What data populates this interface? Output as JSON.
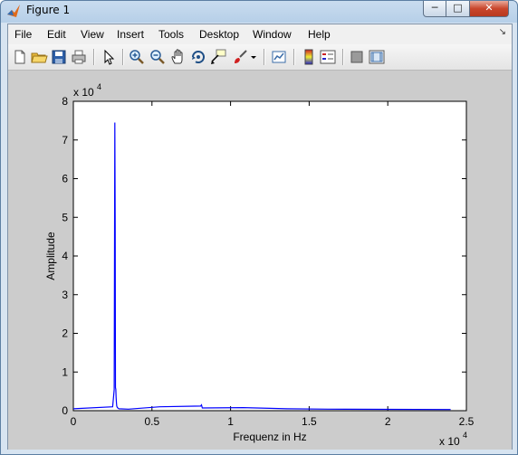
{
  "window": {
    "title": "Figure 1"
  },
  "menu": [
    "File",
    "Edit",
    "View",
    "Insert",
    "Tools",
    "Desktop",
    "Window",
    "Help"
  ],
  "toolbar": [
    "new-figure-icon",
    "open-file-icon",
    "save-icon",
    "print-icon",
    "pointer-icon",
    "zoom-in-icon",
    "zoom-out-icon",
    "pan-hand-icon",
    "rotate-3d-icon",
    "data-cursor-icon",
    "brush-icon",
    "dropdown-arrow-icon",
    "link-plot-icon",
    "colorbar-icon",
    "legend-icon",
    "hide-plot-tools-icon",
    "show-plot-tools-icon"
  ],
  "chart_data": {
    "type": "line",
    "xlabel": "Frequenz in Hz",
    "ylabel": "Amplitude",
    "x_multiplier": "x 10^4",
    "y_multiplier": "x 10^4",
    "xlim": [
      0,
      25000
    ],
    "ylim": [
      0,
      80000
    ],
    "x_tick_labels": [
      "0",
      "0.5",
      "1",
      "1.5",
      "2",
      "2.5"
    ],
    "y_tick_labels": [
      "0",
      "1",
      "2",
      "3",
      "4",
      "5",
      "6",
      "7",
      "8"
    ],
    "series_color": "#0000ff",
    "x": [
      0,
      2500,
      2600,
      2640,
      2660,
      2680,
      2700,
      2720,
      2740,
      2760,
      2800,
      2900,
      3500,
      5500,
      8100,
      8150,
      8200,
      10800,
      13600,
      16200,
      24000
    ],
    "y": [
      500,
      1000,
      5500,
      74500,
      48000,
      6000,
      5500,
      3500,
      2000,
      1200,
      800,
      500,
      400,
      1000,
      1200,
      1500,
      700,
      800,
      500,
      400,
      300
    ]
  }
}
